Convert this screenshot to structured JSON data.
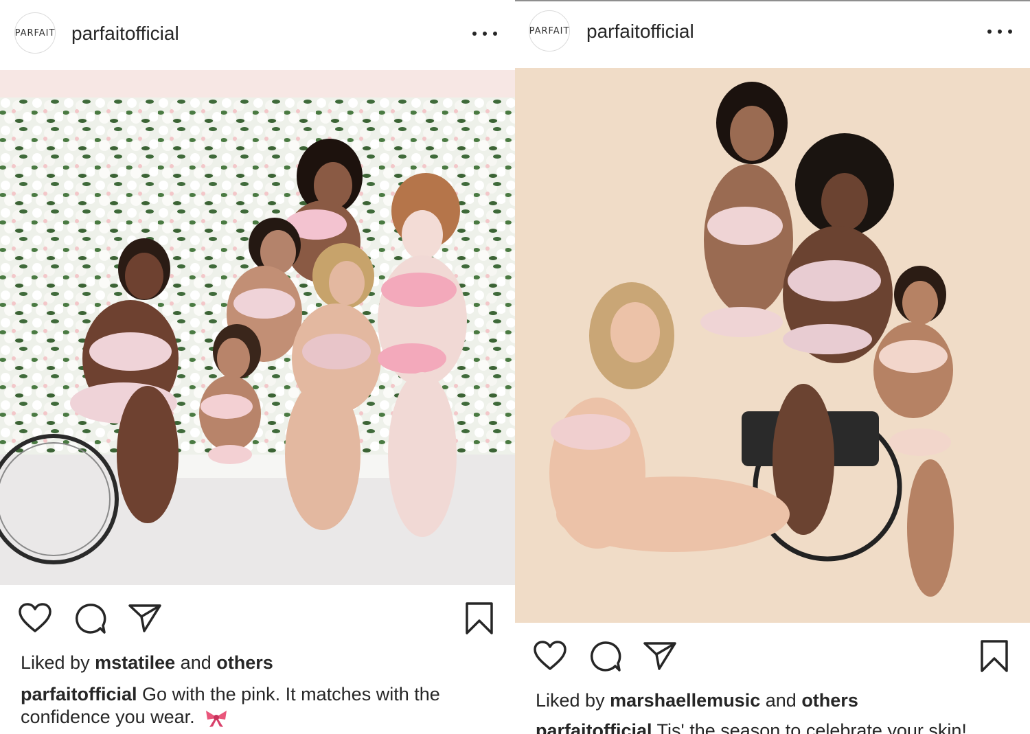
{
  "colors": {
    "text": "#262626",
    "divider": "#8e8e8e",
    "left_photo_bg": "#f1ecef",
    "right_photo_bg": "#f0dcc7"
  },
  "posts": [
    {
      "avatar_text": "PARFAIT",
      "username": "parfaitofficial",
      "more_icon": "ellipsis-icon",
      "photo_icon": "user-tag-icon",
      "liked_by_prefix": "Liked by",
      "liked_by_user": "mstatilee",
      "liked_by_and": "and",
      "liked_by_others": "others",
      "caption_user": "parfaitofficial",
      "caption_text": "Go with the pink. It matches with the confidence you wear.",
      "caption_emoji": "ribbon-icon"
    },
    {
      "avatar_text": "PARFAIT",
      "username": "parfaitofficial",
      "more_icon": "ellipsis-icon",
      "liked_by_prefix": "Liked by",
      "liked_by_user": "marshaellemusic",
      "liked_by_and": "and",
      "liked_by_others": "others",
      "caption_user": "parfaitofficial",
      "caption_text": "Tis' the season to celebrate your skin!"
    }
  ],
  "action_icons": [
    "heart-icon",
    "comment-icon",
    "share-icon",
    "bookmark-icon"
  ]
}
